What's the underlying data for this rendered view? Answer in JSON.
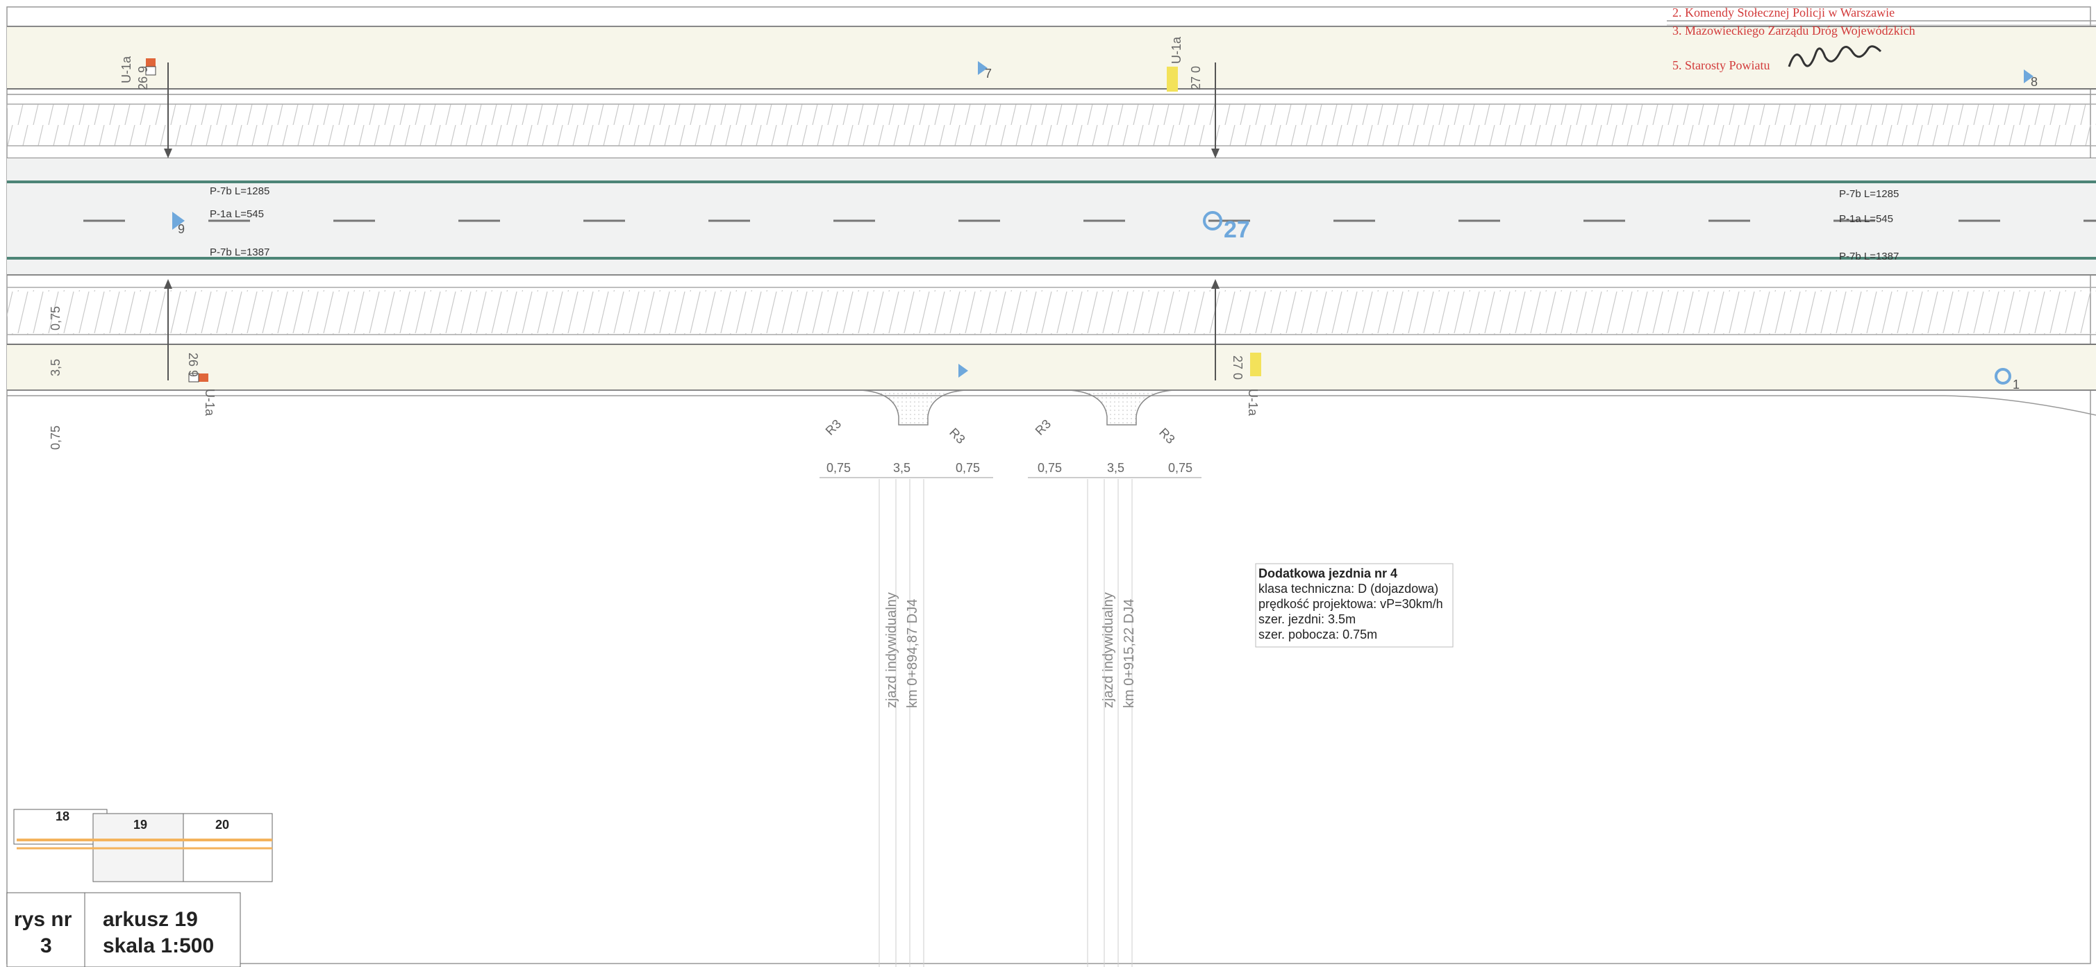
{
  "markings": [
    "P-7b L=1285",
    "P-1a L=545",
    "P-7b L=1387"
  ],
  "stations": {
    "main": "27",
    "s9": "9",
    "s7": "7",
    "s8": "8",
    "s1": "1"
  },
  "signs": {
    "u1a": "U-1a",
    "nw_num": "26  9",
    "ne_num": "27  0",
    "sw_num": "26  9",
    "se_num": "27  0"
  },
  "side_dims": [
    "0,75",
    "3,5",
    "0,75"
  ],
  "driveways": {
    "radius": "R3",
    "shoulder": "0,75",
    "width": "3,5",
    "label": "zjazd indywidualny",
    "km1": "km 0+894,87 DJ4",
    "km2": "km 0+915,22 DJ4"
  },
  "info": {
    "title": "Dodatkowa jezdnia nr 4",
    "lines": [
      "klasa techniczna: D (dojazdowa)",
      "prędkość projektowa: vP=30km/h",
      "szer. jezdni: 3.5m",
      "szer. pobocza: 0.75m"
    ]
  },
  "stamp": [
    "2. Komendy Stołecznej Policji w Warszawie",
    "3. Mazowieckiego Zarządu Dróg Wojewódzkich",
    "",
    "5. Starosty Powiatu",
    ""
  ],
  "index": {
    "s18": "18",
    "s19": "19",
    "s20": "20"
  },
  "title_block": {
    "rys_label": "rys nr",
    "rys_value": "3",
    "sheet_label": "arkusz   19",
    "scale": "skala 1:500"
  }
}
